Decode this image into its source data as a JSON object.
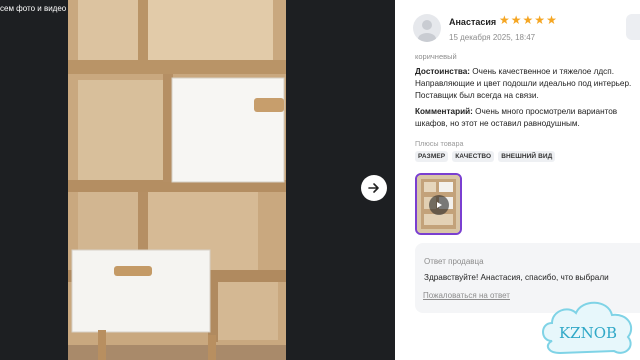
{
  "viewer": {
    "all_media_label": "сем фото и видео"
  },
  "review": {
    "reviewer_name": "Анастасия",
    "rating": 5,
    "date": "15 декабря 2025, 18:47",
    "color": "коричневый",
    "pros_label": "Достоинства:",
    "pros_text_1": " Очень качественное и тяжелое лдсп.",
    "pros_text_2": "Направляющие и цвет подошли идеально под интерьер.",
    "pros_text_3": "Поставщик был всегда на связи.",
    "comment_label": "Комментарий:",
    "comment_text_1": " Очень много просмотрели вариантов",
    "comment_text_2": "шкафов, но этот не оставил равнодушным.",
    "product_pros_label": "Плюсы товара",
    "tags": [
      "РАЗМЕР",
      "КАЧЕСТВО",
      "ВНЕШНИЙ ВИД"
    ]
  },
  "seller": {
    "title": "Ответ продавца",
    "text": "Здравствуйте! Анастасия, спасибо, что выбрали",
    "complain_link": "Пожаловаться на ответ"
  },
  "watermark": {
    "text": "KZNOB"
  },
  "colors": {
    "star": "#f5a623",
    "thumb_border": "#7a3fd1",
    "viewer_bg": "#1d1f22"
  }
}
